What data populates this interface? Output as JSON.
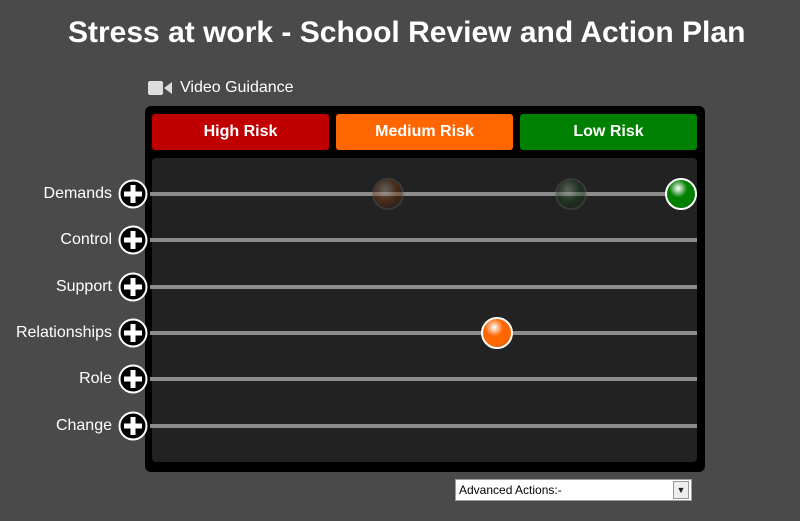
{
  "title": "Stress at work - School Review and Action Plan",
  "video_guidance": {
    "label": "Video Guidance",
    "icon": "video-camera-icon"
  },
  "risk_buttons": [
    {
      "label": "High Risk",
      "color": "#c00000"
    },
    {
      "label": "Medium Risk",
      "color": "#ff6600"
    },
    {
      "label": "Low Risk",
      "color": "#008000"
    }
  ],
  "rows": [
    {
      "label": "Demands",
      "rating": "Low Risk"
    },
    {
      "label": "Control",
      "rating": ""
    },
    {
      "label": "Support",
      "rating": ""
    },
    {
      "label": "Relationships",
      "rating": "Medium Risk"
    },
    {
      "label": "Role",
      "rating": ""
    },
    {
      "label": "Change",
      "rating": ""
    }
  ],
  "advanced_actions": {
    "value": "Advanced Actions:-"
  }
}
